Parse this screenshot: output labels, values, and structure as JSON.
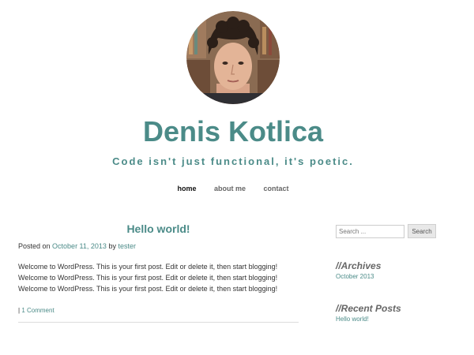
{
  "site": {
    "title": "Denis Kotlica",
    "tagline": "Code isn't just functional, it's poetic."
  },
  "nav": {
    "items": [
      {
        "label": "home"
      },
      {
        "label": "about me"
      },
      {
        "label": "contact"
      }
    ]
  },
  "post": {
    "title": "Hello world!",
    "meta_posted_prefix": "Posted on",
    "meta_date": "October 11, 2013",
    "meta_by": "by",
    "meta_author": "tester",
    "body": "Welcome to WordPress. This is your first post. Edit or delete it, then start blogging! Welcome to WordPress. This is your first post. Edit or delete it, then start blogging! Welcome to WordPress. This is your first post. Edit or delete it, then start blogging!",
    "comments_separator": "|",
    "comments_link": "1 Comment"
  },
  "sidebar": {
    "search_placeholder": "Search ...",
    "search_button": "Search",
    "archives_title": "//Archives",
    "archives_items": [
      "October 2013"
    ],
    "recent_title": "//Recent Posts",
    "recent_items": [
      "Hello world!"
    ]
  },
  "colors": {
    "accent": "#4b8b88",
    "text": "#333333",
    "widget_title": "#666666"
  }
}
